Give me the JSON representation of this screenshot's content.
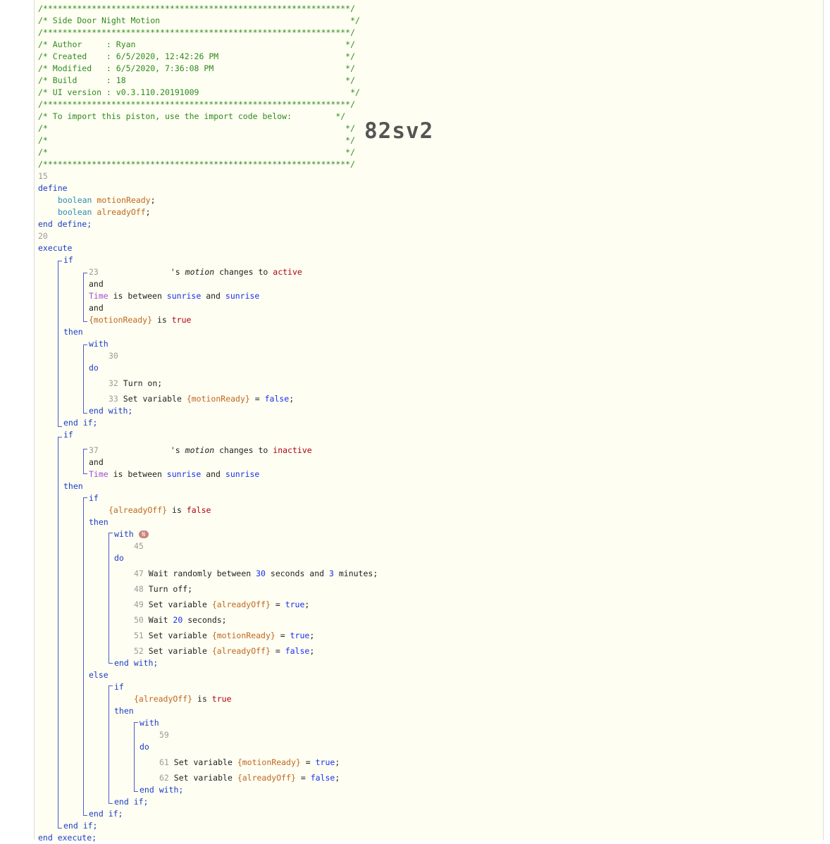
{
  "header": {
    "border_top": "/***************************************************************/",
    "title_line": "/* Side Door Night Motion                                       */",
    "border_mid": "/***************************************************************/",
    "author_line": "/* Author     : Ryan                                           */",
    "created_line": "/* Created    : 6/5/2020, 12:42:26 PM                          */",
    "modified_line": "/* Modified   : 6/5/2020, 7:36:08 PM                           */",
    "build_line": "/* Build      : 18                                             */",
    "ui_line": "/* UI version : v0.3.110.20191009                               */",
    "border_mid2": "/***************************************************************/",
    "import_line": "/* To import this piston, use the import code below:         */",
    "blank1": "/*                                                             */",
    "blank2": "/*                                                             */",
    "blank3": "/*                                                             */",
    "border_bot": "/***************************************************************/"
  },
  "import_code": "82sv2",
  "keywords": {
    "define": "define",
    "boolean": "boolean",
    "end_define": "end define;",
    "execute": "execute",
    "if": "if",
    "and": "and",
    "then": "then",
    "with": "with",
    "do": "do",
    "end_with": "end with;",
    "end_if": "end if;",
    "else": "else",
    "end_execute": "end execute;"
  },
  "variables": {
    "motionReady": "motionReady",
    "alreadyOff": "alreadyOff",
    "motionReady_ref": "{motionReady}",
    "alreadyOff_ref": "{alreadyOff}"
  },
  "values": {
    "true": "true",
    "false": "false",
    "active": "active",
    "inactive": "inactive",
    "sunrise": "sunrise",
    "n30": "30",
    "n3": "3",
    "n20": "20",
    "badge": "N"
  },
  "phrases": {
    "motion_prefix": "'s ",
    "motion": "motion",
    "changes_to": " changes to ",
    "time": "Time",
    "is_between": " is between ",
    "and_text": " and ",
    "is": " is ",
    "turn_on": "Turn on;",
    "turn_off": "Turn off;",
    "set_variable": "Set variable ",
    "eq": " = ",
    "semi": ";",
    "wait_random": "Wait randomly between ",
    "seconds_and": " seconds and ",
    "minutes": " minutes;",
    "wait": "Wait ",
    "seconds": " seconds;"
  },
  "line_numbers": {
    "l15": "15",
    "l20": "20",
    "l23": "23",
    "l30": "30",
    "l32": "32",
    "l33": "33",
    "l37": "37",
    "l45": "45",
    "l47": "47",
    "l48": "48",
    "l49": "49",
    "l50": "50",
    "l51": "51",
    "l52": "52",
    "l59": "59",
    "l61": "61",
    "l62": "62"
  }
}
